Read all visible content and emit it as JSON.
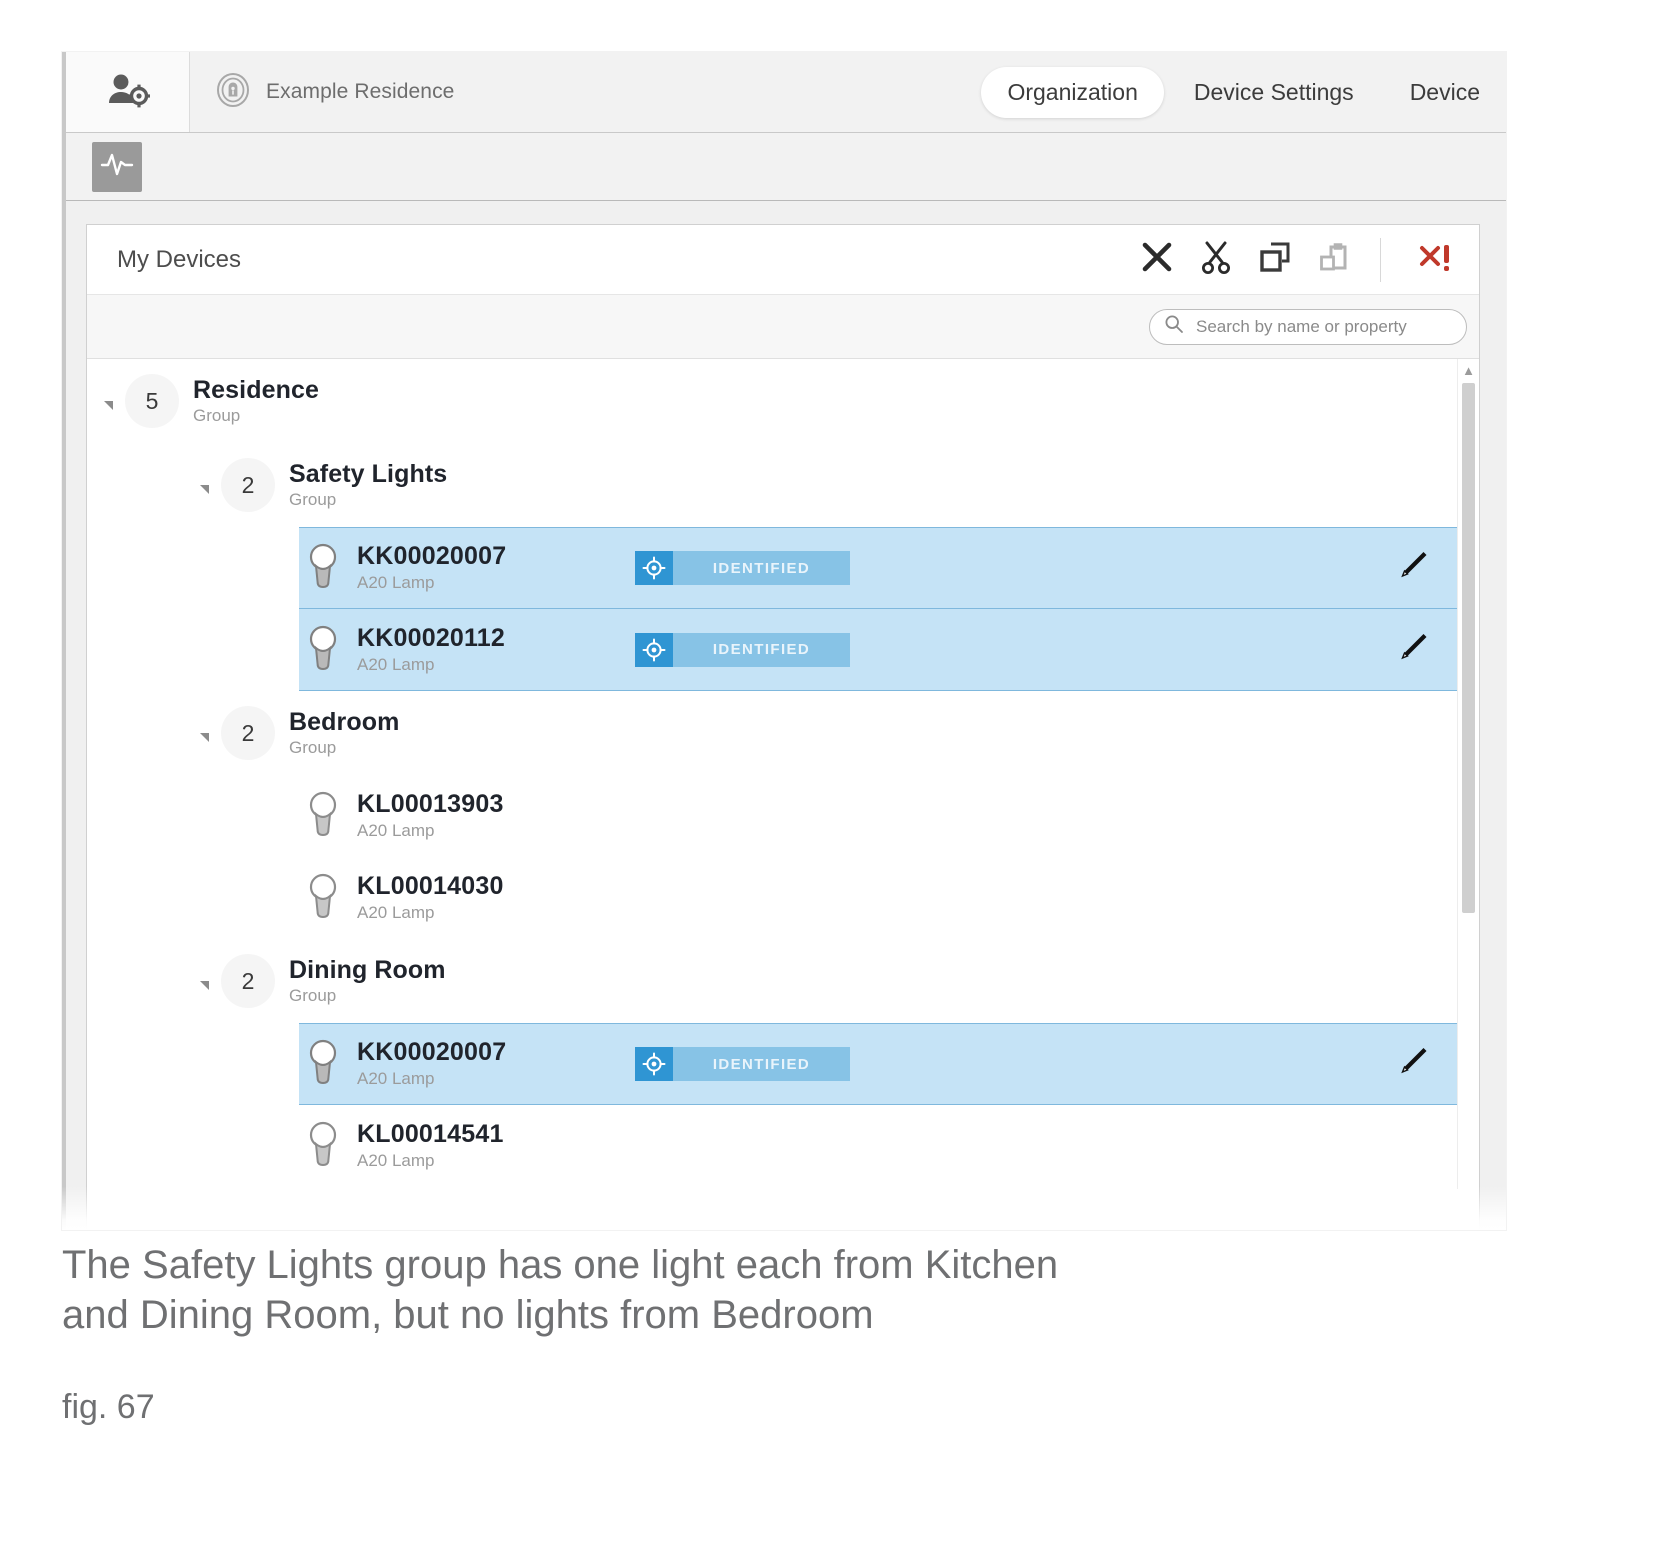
{
  "app": {
    "org_name": "Example Residence",
    "user_icon": "user-settings-icon",
    "org_icon": "building-badge-icon",
    "tabs": [
      {
        "label": "Organization",
        "active": true
      },
      {
        "label": "Device Settings",
        "active": false
      },
      {
        "label": "Device",
        "active": false
      }
    ],
    "subbar": {
      "pulse_icon": "activity-pulse-icon"
    }
  },
  "panel": {
    "title": "My Devices",
    "actions": [
      {
        "name": "delete-icon",
        "label": "Delete"
      },
      {
        "name": "cut-icon",
        "label": "Cut"
      },
      {
        "name": "copy-icon",
        "label": "Copy"
      },
      {
        "name": "paste-icon",
        "label": "Paste"
      },
      {
        "name": "remove-all-icon",
        "label": "Remove"
      }
    ],
    "search": {
      "placeholder": "Search by name or property",
      "value": "",
      "icon": "search-icon"
    }
  },
  "tree": {
    "root": {
      "name": "Residence",
      "type": "Group",
      "count": "5"
    },
    "groups": [
      {
        "name": "Safety Lights",
        "type": "Group",
        "count": "2",
        "devices": [
          {
            "id": "KK00020007",
            "type": "A20 Lamp",
            "status": "IDENTIFIED",
            "selected": true,
            "editable": true
          },
          {
            "id": "KK00020112",
            "type": "A20 Lamp",
            "status": "IDENTIFIED",
            "selected": true,
            "editable": true
          }
        ]
      },
      {
        "name": "Bedroom",
        "type": "Group",
        "count": "2",
        "devices": [
          {
            "id": "KL00013903",
            "type": "A20 Lamp",
            "status": "",
            "selected": false,
            "editable": false
          },
          {
            "id": "KL00014030",
            "type": "A20 Lamp",
            "status": "",
            "selected": false,
            "editable": false
          }
        ]
      },
      {
        "name": "Dining Room",
        "type": "Group",
        "count": "2",
        "devices": [
          {
            "id": "KK00020007",
            "type": "A20 Lamp",
            "status": "IDENTIFIED",
            "selected": true,
            "editable": true
          },
          {
            "id": "KL00014541",
            "type": "A20 Lamp",
            "status": "",
            "selected": false,
            "editable": false
          }
        ]
      }
    ]
  },
  "caption": {
    "line1": "The Safety Lights group has one light each from Kitchen",
    "line2": "and Dining Room, but no lights from Bedroom",
    "figure": "fig. 67"
  },
  "colors": {
    "selection_fill": "#c5e3f6",
    "selection_border": "#7fb8dd",
    "badge_bg": "#87c3e6",
    "badge_icon_bg": "#2f95d3",
    "remove_red": "#c0392b",
    "text_dark": "#20242c",
    "text_muted": "#9b9b9b"
  }
}
